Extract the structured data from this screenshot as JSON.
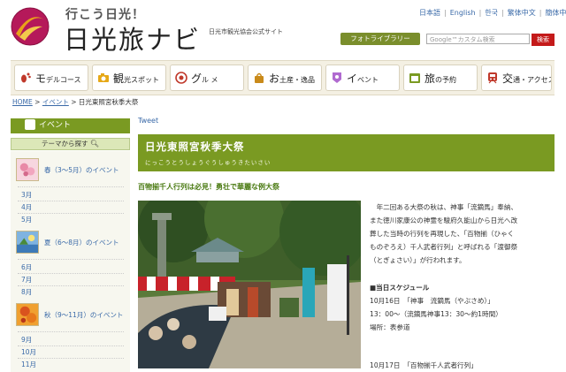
{
  "header": {
    "tagline": "行こう日光！",
    "title": "日光旅ナビ",
    "subtitle": "日光市観光協会公式サイト",
    "languages": [
      "日本語",
      "English",
      "한국",
      "繁体中文",
      "簡体中文"
    ],
    "photo_library": "フォトライブラリー",
    "search_placeholder": "Google™カスタム検索",
    "search_button": "検索"
  },
  "nav": {
    "items": [
      {
        "label": "モ",
        "small": "デルコース",
        "icon": "footprint-icon"
      },
      {
        "label": "観",
        "small": "光スポット",
        "icon": "camera-icon"
      },
      {
        "label": "グ",
        "small": "ル メ",
        "icon": "gourmet-icon"
      },
      {
        "label": "お",
        "small": "土産・逸品",
        "icon": "bag-icon"
      },
      {
        "label": "イ",
        "small": "ベント",
        "icon": "event-icon"
      },
      {
        "label": "旅",
        "small": "の予約",
        "icon": "reservation-icon"
      },
      {
        "label": "交",
        "small": "通・アクセス",
        "icon": "train-icon"
      }
    ]
  },
  "breadcrumb": {
    "home": "HOME",
    "sep": " > ",
    "event": "イベント",
    "current": "日光東照宮秋季大祭"
  },
  "sidebar": {
    "title": "イベント",
    "theme": "テーマから探す",
    "seasons": [
      {
        "label": "春（3～5月）のイベント",
        "months": [
          "3月",
          "4月",
          "5月"
        ]
      },
      {
        "label": "夏（6～8月）のイベント",
        "months": [
          "6月",
          "7月",
          "8月"
        ]
      },
      {
        "label": "秋（9～11月）のイベント",
        "months": [
          "9月",
          "10月",
          "11月"
        ]
      }
    ]
  },
  "main": {
    "tweet": "Tweet",
    "title": "日光東照宮秋季大祭",
    "title_kana": "にっこうとうしょうぐうしゅうきたいさい",
    "lead": "百物揃千人行列は必見！勇壮で華麗な例大祭",
    "body": [
      "　年二回ある大祭の秋は、神事「流鏑馬」奉納、",
      "また徳川家康公の神霊を駿府久能山から日光へ改",
      "葬した当時の行列を再現した、「百物揃（ひゃく",
      "ものぞろえ）千人武者行列」と呼ばれる「渡御祭",
      "（とぎょさい）」が行われます。"
    ],
    "schedule_heading": "■当日スケジュール",
    "schedule": [
      "10月16日　「神事　流鏑馬（やぶさめ）」",
      "13：00～（流鏑馬神事13：30～約1時間）",
      "場所：表参道"
    ],
    "next_day": "10月17日　「百物揃千人武者行列」"
  }
}
